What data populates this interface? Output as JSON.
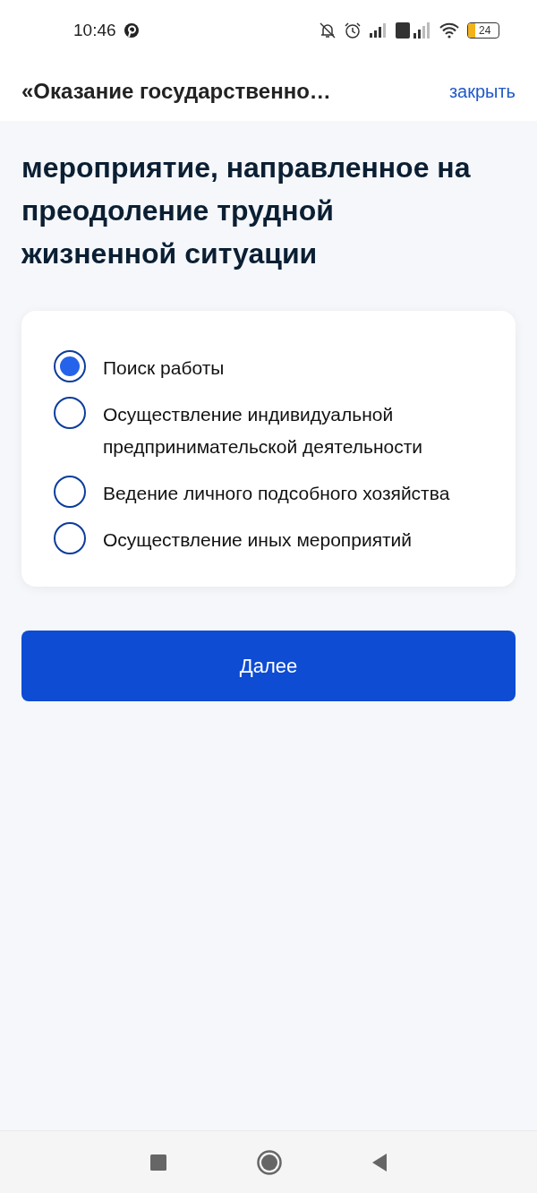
{
  "status_bar": {
    "time": "10:46",
    "battery": "24"
  },
  "header": {
    "title": "«Оказание государственно…",
    "close": "закрыть"
  },
  "question": "мероприятие, направленное на преодоление трудной жизненной ситуации",
  "options": [
    {
      "label": "Поиск работы",
      "selected": true
    },
    {
      "label": "Осуществление индивидуальной предпринимательской деятельности",
      "selected": false
    },
    {
      "label": "Ведение личного подсобного хозяйства",
      "selected": false
    },
    {
      "label": "Осуществление иных мероприятий",
      "selected": false
    }
  ],
  "next_button": "Далее"
}
